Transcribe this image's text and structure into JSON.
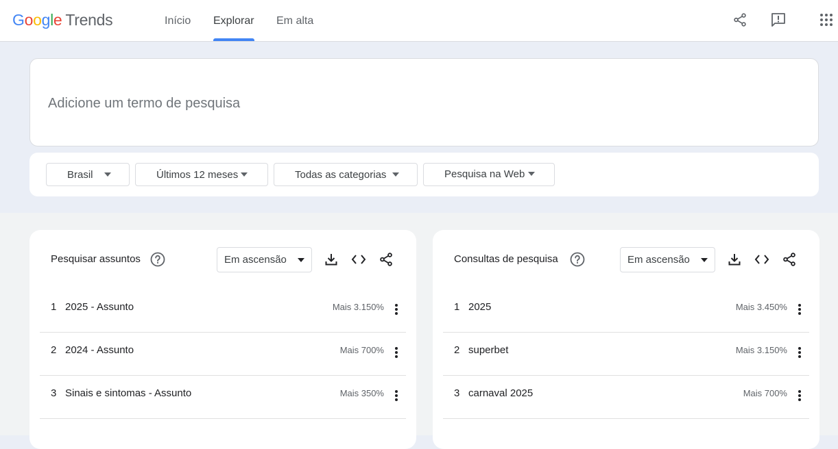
{
  "app": {
    "logo": [
      "G",
      "o",
      "o",
      "g",
      "l",
      "e"
    ],
    "logo_suffix": "Trends"
  },
  "nav": {
    "tabs": [
      {
        "label": "Início"
      },
      {
        "label": "Explorar"
      },
      {
        "label": "Em alta"
      }
    ],
    "active_tab": "Explorar",
    "accent_color": "#4285f4"
  },
  "header_icons": [
    "share-icon",
    "feedback-icon",
    "apps-grid-icon"
  ],
  "search": {
    "placeholder": "Adicione um termo de pesquisa",
    "value": ""
  },
  "filters": [
    {
      "label": "Brasil"
    },
    {
      "label": "Últimos 12 meses"
    },
    {
      "label": "Todas as categorias"
    },
    {
      "label": "Pesquisa na Web"
    }
  ],
  "panels": [
    {
      "title": "Pesquisar assuntos",
      "sort": "Em ascensão",
      "rows": [
        {
          "rank": "1",
          "term": "2025 - Assunto",
          "value": "Mais 3.150%"
        },
        {
          "rank": "2",
          "term": "2024 - Assunto",
          "value": "Mais 700%"
        },
        {
          "rank": "3",
          "term": "Sinais e sintomas - Assunto",
          "value": "Mais 350%"
        }
      ]
    },
    {
      "title": "Consultas de pesquisa",
      "sort": "Em ascensão",
      "rows": [
        {
          "rank": "1",
          "term": "2025",
          "value": "Mais 3.450%"
        },
        {
          "rank": "2",
          "term": "superbet",
          "value": "Mais 3.150%"
        },
        {
          "rank": "3",
          "term": "carnaval 2025",
          "value": "Mais 700%"
        }
      ]
    }
  ]
}
